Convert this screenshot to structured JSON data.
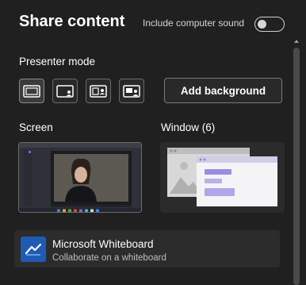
{
  "header": {
    "title": "Share content",
    "sound_label": "Include computer sound",
    "sound_toggle_on": false
  },
  "presenter": {
    "label": "Presenter mode",
    "modes": [
      {
        "icon": "content-only-icon",
        "selected": true
      },
      {
        "icon": "standout-icon",
        "selected": false
      },
      {
        "icon": "side-by-side-icon",
        "selected": false
      },
      {
        "icon": "reporter-icon",
        "selected": false
      }
    ],
    "add_background_label": "Add background"
  },
  "sources": {
    "screen_label": "Screen",
    "window_label": "Window (6)"
  },
  "whiteboard": {
    "title": "Microsoft Whiteboard",
    "subtitle": "Collaborate on a whiteboard",
    "icon": "whiteboard-icon"
  },
  "colors": {
    "background": "#202020",
    "accent": "#1f5bb5",
    "window_preview_highlight": "#9a8ee0"
  }
}
